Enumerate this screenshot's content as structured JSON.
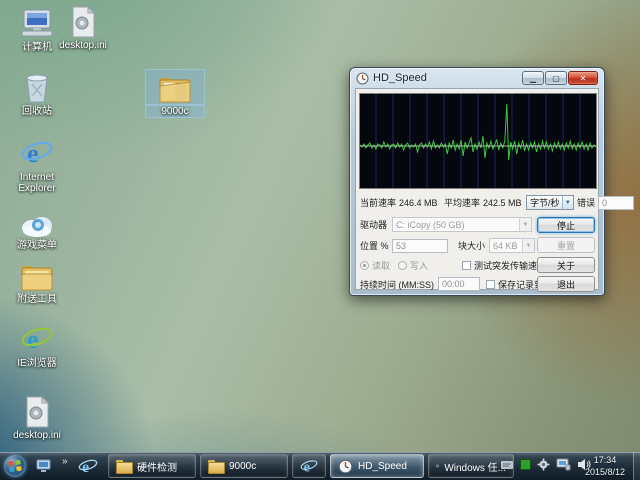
{
  "desktop": {
    "icons": [
      {
        "label": "计算机"
      },
      {
        "label": "desktop.ini"
      },
      {
        "label": "回收站"
      },
      {
        "label": "Internet Explorer"
      },
      {
        "label": "游戏菜单"
      },
      {
        "label": "附送工具"
      },
      {
        "label": "IE浏览器"
      },
      {
        "label": "desktop.ini"
      },
      {
        "label": "9000c"
      }
    ]
  },
  "window": {
    "title": "HD_Speed",
    "stats": {
      "current_label": "当前速率",
      "current_value": "246.4 MB",
      "average_label": "平均速率",
      "average_value": "242.5 MB",
      "unit_value": "字节/秒",
      "errors_label": "错误",
      "errors_value": "0"
    },
    "drive_label": "驱动器",
    "drive_value": "C: iCopy (50 GB)",
    "position_label": "位置 %",
    "position_value": "53",
    "block_label": "块大小",
    "block_value": "64 KB",
    "read_label": "读取",
    "write_label": "写入",
    "duration_label": "持续时间 (MM:SS)",
    "duration_value": "00:00",
    "burst_label": "测试突发传输速率",
    "save_label": "保存记录到文件",
    "buttons": {
      "stop": "停止",
      "reset": "重置",
      "about": "关于",
      "exit": "退出"
    }
  },
  "graph": {
    "baseline_frac": 0.55,
    "values": [
      1,
      -1,
      2,
      -2,
      1,
      3,
      -2,
      1,
      -3,
      2,
      1,
      -2,
      4,
      -1,
      2,
      -3,
      1,
      2,
      -2,
      3,
      -1,
      2,
      -4,
      1,
      3,
      -2,
      1,
      -1,
      2,
      -6,
      1,
      3,
      -2,
      2,
      -1,
      4,
      -3,
      5,
      -2,
      1,
      -2,
      3,
      -1,
      2,
      -8,
      3,
      -2,
      6,
      -4,
      2,
      -3,
      6,
      -10,
      4,
      -2,
      3,
      8,
      -6,
      2,
      -3,
      4,
      -2,
      10,
      -12,
      3,
      -2,
      5,
      -3,
      2,
      6,
      -4,
      3,
      -2,
      5,
      42,
      -14,
      4,
      -3,
      5,
      -8,
      3,
      -2,
      6,
      -5,
      2,
      -4,
      3,
      -2,
      4,
      -6,
      2,
      -3,
      5,
      -2,
      4,
      -3,
      2,
      -5,
      3,
      -2,
      4,
      -3,
      2,
      -4,
      3,
      -2,
      5,
      -3,
      2,
      -4,
      3,
      -2,
      4,
      -3,
      2,
      -4,
      3,
      -2,
      1,
      -1
    ],
    "colors": {
      "bg": "#04070d",
      "grid": "#1a2560",
      "trace": "#38c93c",
      "baseline": "#cdd3c4"
    }
  },
  "taskbar": {
    "overflow_chevron": "»",
    "buttons": [
      {
        "label": "硬件检测"
      },
      {
        "label": "9000c"
      },
      {
        "label": ""
      },
      {
        "label": "HD_Speed",
        "active": true
      },
      {
        "label": "Windows 任..."
      }
    ],
    "tray": {
      "clock_time": "17:34",
      "clock_date": "2015/8/12"
    }
  },
  "colors": {
    "close_button": "#c23b2a",
    "taskbar_active": "#9cc4e0",
    "selection": "#82b4e1"
  }
}
